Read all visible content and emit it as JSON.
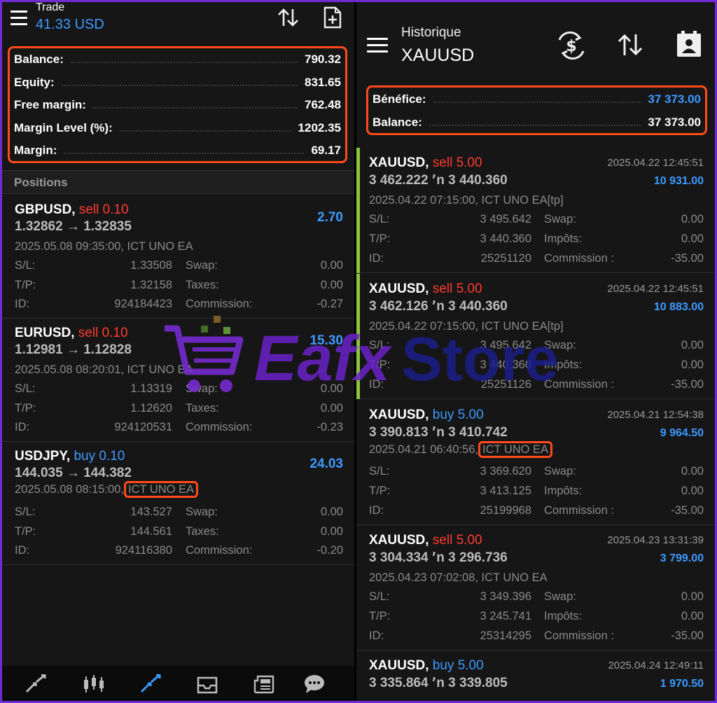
{
  "left": {
    "header": {
      "title": "Trade",
      "subtitle": "41.33 USD"
    },
    "summary": [
      {
        "label": "Balance:",
        "value": "790.32"
      },
      {
        "label": "Equity:",
        "value": "831.65"
      },
      {
        "label": "Free margin:",
        "value": "762.48"
      },
      {
        "label": "Margin Level (%):",
        "value": "1202.35"
      },
      {
        "label": "Margin:",
        "value": "69.17"
      }
    ],
    "positions_header": "Positions",
    "positions": [
      {
        "symbol": "GBPUSD,",
        "side": "sell 0.10",
        "side_type": "sell",
        "prices": "1.32862 → 1.32835",
        "profit": "2.70",
        "info": "2025.05.08 09:35:00, ICT UNO EA",
        "rows": [
          [
            "S/L:",
            "1.33508",
            "Swap:",
            "0.00"
          ],
          [
            "T/P:",
            "1.32158",
            "Taxes:",
            "0.00"
          ],
          [
            "ID:",
            "924184423",
            "Commission:",
            "-0.27"
          ]
        ]
      },
      {
        "symbol": "EURUSD,",
        "side": "sell 0.10",
        "side_type": "sell",
        "prices": "1.12981 → 1.12828",
        "profit": "15.30",
        "info": "2025.05.08 08:20:01, ICT UNO EA",
        "rows": [
          [
            "S/L:",
            "1.13319",
            "Swap:",
            "0.00"
          ],
          [
            "T/P:",
            "1.12620",
            "Taxes:",
            "0.00"
          ],
          [
            "ID:",
            "924120531",
            "Commission:",
            "-0.23"
          ]
        ]
      },
      {
        "symbol": "USDJPY,",
        "side": "buy 0.10",
        "side_type": "buy",
        "prices": "144.035 → 144.382",
        "profit": "24.03",
        "info_time": "2025.05.08 08:15:00,",
        "info_ea": "ICT UNO EA",
        "rows": [
          [
            "S/L:",
            "143.527",
            "Swap:",
            "0.00"
          ],
          [
            "T/P:",
            "144.561",
            "Taxes:",
            "0.00"
          ],
          [
            "ID:",
            "924116380",
            "Commission:",
            "-0.20"
          ]
        ]
      }
    ]
  },
  "right": {
    "header": {
      "title": "Historique",
      "subtitle": "XAUUSD"
    },
    "summary": [
      {
        "label": "Bénéfice:",
        "value": "37 373.00"
      },
      {
        "label": "Balance:",
        "value": "37 373.00"
      }
    ],
    "deals": [
      {
        "symbol": "XAUUSD,",
        "side": "sell 5.00",
        "side_type": "sell",
        "time": "2025.04.22 12:45:51",
        "prices": "3 462.222 ՚n  3 440.360",
        "profit": "10 931.00",
        "info": "2025.04.22 07:15:00, ICT UNO EA[tp]",
        "rows": [
          [
            "S/L:",
            "3 495.642",
            "Swap:",
            "0.00"
          ],
          [
            "T/P:",
            "3 440.360",
            "Impôts:",
            "0.00"
          ],
          [
            "ID:",
            "25251120",
            "Commission :",
            "-35.00"
          ]
        ]
      },
      {
        "symbol": "XAUUSD,",
        "side": "sell 5.00",
        "side_type": "sell",
        "time": "2025.04.22 12:45:51",
        "prices": "3 462.126 ՚n  3 440.360",
        "profit": "10 883.00",
        "info": "2025.04.22 07:15:00, ICT UNO EA[tp]",
        "rows": [
          [
            "S/L:",
            "3 495.642",
            "Swap:",
            "0.00"
          ],
          [
            "T/P:",
            "3 440.360",
            "Impôts:",
            "0.00"
          ],
          [
            "ID:",
            "25251126",
            "Commission :",
            "-35.00"
          ]
        ]
      },
      {
        "symbol": "XAUUSD,",
        "side": "buy 5.00",
        "side_type": "buy",
        "time": "2025.04.21 12:54:38",
        "prices": "3 390.813 ՚n  3 410.742",
        "profit": "9 964.50",
        "info_time": "2025.04.21 06:40:56,",
        "info_ea": "ICT UNO EA",
        "rows": [
          [
            "S/L:",
            "3 369.620",
            "Swap:",
            "0.00"
          ],
          [
            "T/P:",
            "3 413.125",
            "Impôts:",
            "0.00"
          ],
          [
            "ID:",
            "25199968",
            "Commission :",
            "-35.00"
          ]
        ]
      },
      {
        "symbol": "XAUUSD,",
        "side": "sell 5.00",
        "side_type": "sell",
        "time": "2025.04.23 13:31:39",
        "prices": "3 304.334 ՚n  3 296.736",
        "profit": "3 799.00",
        "info": "2025.04.23 07:02:08, ICT UNO EA",
        "rows": [
          [
            "S/L:",
            "3 349.396",
            "Swap:",
            "0.00"
          ],
          [
            "T/P:",
            "3 245.741",
            "Impôts:",
            "0.00"
          ],
          [
            "ID:",
            "25314295",
            "Commission :",
            "-35.00"
          ]
        ]
      },
      {
        "symbol": "XAUUSD,",
        "side": "buy 5.00",
        "side_type": "buy",
        "time": "2025.04.24 12:49:11",
        "prices": "3 335.864 ՚n  3 339.805",
        "profit": "1 970.50"
      }
    ]
  },
  "watermark": {
    "text_a": "Eafx",
    "text_b": "Store"
  },
  "colors": {
    "accent_blue": "#3d9aff",
    "sell_red": "#ff3b30",
    "highlight_orange": "#ff4a1a",
    "tp_green": "#8ac43f"
  },
  "icons": [
    "menu-icon",
    "sort-icon",
    "new-order-icon",
    "dollar-exchange-icon",
    "report-icon",
    "quotes-icon",
    "chart-icon",
    "trade-icon",
    "mailbox-icon",
    "news-icon",
    "chat-icon"
  ]
}
